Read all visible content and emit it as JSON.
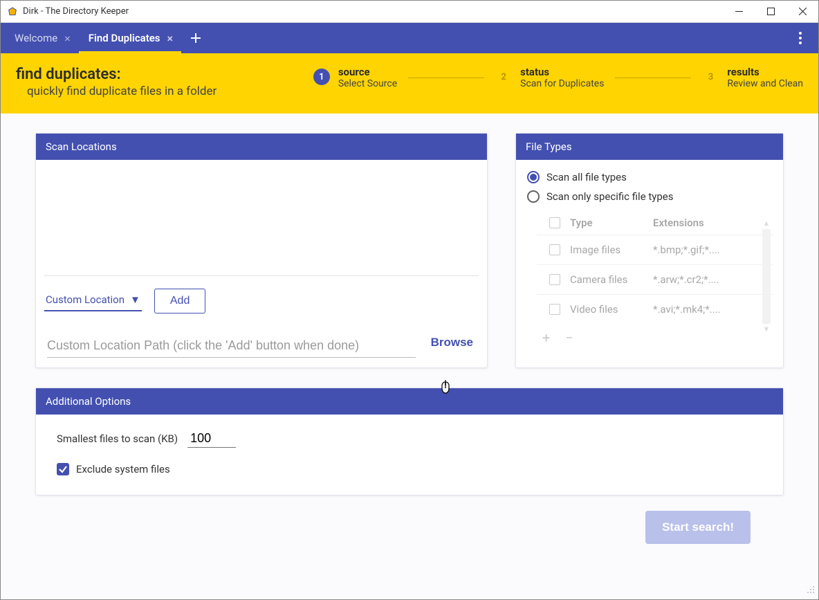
{
  "window": {
    "title": "Dirk - The Directory Keeper"
  },
  "tabs": {
    "welcome": {
      "label": "Welcome"
    },
    "duplicates": {
      "label": "Find Duplicates"
    }
  },
  "hero": {
    "title": "find duplicates:",
    "subtitle": "quickly find duplicate files in a folder"
  },
  "steps": {
    "s1": {
      "num": "1",
      "title": "source",
      "sub": "Select Source"
    },
    "s2": {
      "num": "2",
      "title": "status",
      "sub": "Scan for Duplicates"
    },
    "s3": {
      "num": "3",
      "title": "results",
      "sub": "Review and Clean"
    }
  },
  "panels": {
    "scan": {
      "title": "Scan Locations",
      "location_type": "Custom Location",
      "add_label": "Add",
      "path_placeholder": "Custom Location Path (click the 'Add' button when done)",
      "browse_label": "Browse"
    },
    "types": {
      "title": "File Types",
      "radio_all": "Scan all file types",
      "radio_specific": "Scan only specific file types",
      "col_type": "Type",
      "col_ext": "Extensions",
      "rows": [
        {
          "type": "Image files",
          "ext": "*.bmp;*.gif;*...."
        },
        {
          "type": "Camera files",
          "ext": "*.arw;*.cr2;*...."
        },
        {
          "type": "Video files",
          "ext": "*.avi;*.mk4;*...."
        }
      ],
      "add_icon": "+",
      "remove_icon": "−"
    },
    "opts": {
      "title": "Additional Options",
      "smallest_label": "Smallest files to scan (KB)",
      "smallest_value": "100",
      "exclude_label": "Exclude system files"
    }
  },
  "footer": {
    "start_label": "Start search!"
  }
}
